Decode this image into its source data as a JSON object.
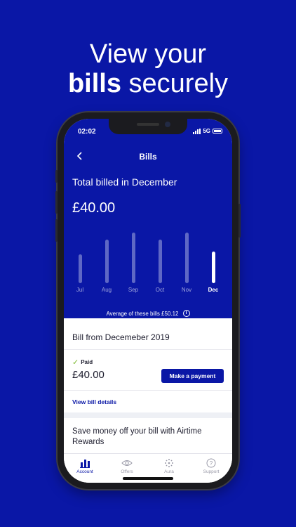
{
  "headline": {
    "line1": "View your",
    "line2_bold": "bills",
    "line2_rest": " securely"
  },
  "status": {
    "time": "02:02",
    "network": "5G"
  },
  "nav": {
    "title": "Bills"
  },
  "summary": {
    "label": "Total billed in December",
    "amount": "£40.00"
  },
  "chart_data": {
    "type": "bar",
    "categories": [
      "Jul",
      "Aug",
      "Sep",
      "Oct",
      "Nov",
      "Dec"
    ],
    "values": [
      40,
      60,
      70,
      60,
      70,
      44
    ],
    "selected": "Dec",
    "average_label": "Average of these bills £50.12"
  },
  "bill": {
    "title": "Bill from Decemeber 2019",
    "status": "Paid",
    "amount": "£40.00",
    "pay_button": "Make a payment",
    "details_link": "View bill details"
  },
  "promo": {
    "text": "Save money off your bill with Airtime Rewards"
  },
  "tabs": [
    {
      "label": "Account",
      "icon": "bar-chart-icon",
      "active": true
    },
    {
      "label": "Offers",
      "icon": "eye-icon",
      "active": false
    },
    {
      "label": "Aura",
      "icon": "dots-icon",
      "active": false
    },
    {
      "label": "Support",
      "icon": "question-icon",
      "active": false
    }
  ],
  "colors": {
    "brand": "#0a17a6",
    "paid_check": "#7ab82c"
  }
}
